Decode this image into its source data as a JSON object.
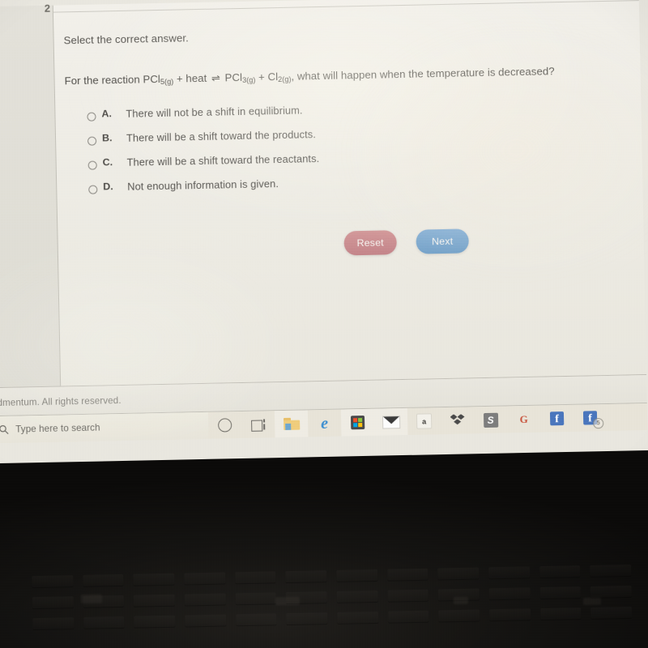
{
  "quiz": {
    "page_number": "2",
    "prompt": "Select the correct answer.",
    "question": {
      "lead": "For the reaction PCl",
      "sub1": "5(g)",
      "mid1": " + heat ",
      "arrow": "⇌",
      "mid2": " PCl",
      "sub2": "3(g)",
      "mid3": " + Cl",
      "sub3": "2(g)",
      "tail": ", what will happen when the temperature is decreased?",
      "full_text": "For the reaction PCl5(g) + heat ⇌ PCl3(g) + Cl2(g), what will happen when the temperature is decreased?"
    },
    "options": [
      {
        "letter": "A.",
        "text": "There will not be a shift in equilibrium.",
        "selected": false
      },
      {
        "letter": "B.",
        "text": "There will be a shift toward the products.",
        "selected": false
      },
      {
        "letter": "C.",
        "text": "There will be a shift toward the reactants.",
        "selected": false
      },
      {
        "letter": "D.",
        "text": "Not enough information is given.",
        "selected": false
      }
    ],
    "buttons": {
      "reset_label": "Reset",
      "next_label": "Next",
      "reset_color": "#c4858a",
      "next_color": "#74a2c9"
    },
    "footer_text": "dmentum. All rights reserved."
  },
  "taskbar": {
    "search_placeholder": "Type here to search",
    "search_icon": "search-icon",
    "items": [
      {
        "name": "cortana-icon",
        "label": "Cortana"
      },
      {
        "name": "task-view-icon",
        "label": "Task View"
      },
      {
        "name": "file-explorer-icon",
        "label": "File Explorer"
      },
      {
        "name": "edge-icon",
        "label": "Microsoft Edge",
        "glyph": "e"
      },
      {
        "name": "microsoft-store-icon",
        "label": "Microsoft Store"
      },
      {
        "name": "mail-icon",
        "label": "Mail"
      },
      {
        "name": "amazon-icon",
        "label": "Amazon",
        "glyph": "a"
      },
      {
        "name": "dropbox-icon",
        "label": "Dropbox"
      },
      {
        "name": "skype-icon",
        "label": "Skype",
        "glyph": "S"
      },
      {
        "name": "google-icon",
        "label": "Google",
        "glyph": "G"
      },
      {
        "name": "facebook-icon",
        "label": "Facebook",
        "glyph": "f"
      },
      {
        "name": "facebook-icon-2",
        "label": "Facebook",
        "glyph": "f",
        "badge": "5"
      }
    ]
  }
}
